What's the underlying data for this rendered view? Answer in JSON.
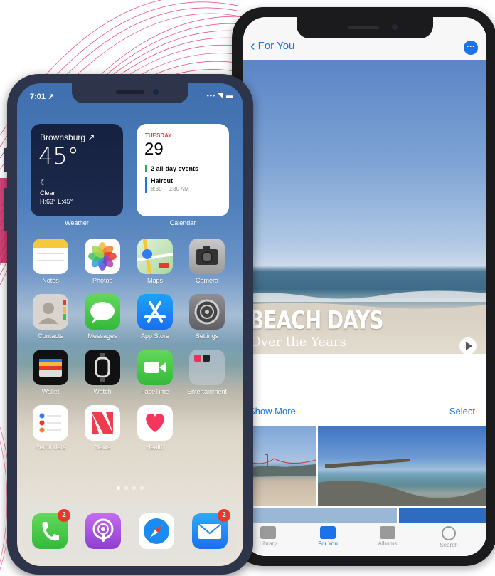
{
  "colors": {
    "accent": "#1a73e8",
    "phone_left_frame": "#2e3449",
    "phone_right_frame": "#1b1b1d",
    "badge": "#e8372c",
    "decor_lines": "#e0245e"
  },
  "left_phone": {
    "status": {
      "time": "7:01 ↗",
      "system": "••• ◥ ▬"
    },
    "weather_widget": {
      "city": "Brownsburg ↗",
      "temp": "45°",
      "moon": "☾",
      "condition": "Clear",
      "hilo": "H:63° L:45°",
      "label": "Weather"
    },
    "calendar_widget": {
      "day": "TUESDAY",
      "date": "29",
      "event1": "2 all-day events",
      "event2_title": "Haircut",
      "event2_time": "8:30 – 9:30 AM",
      "label": "Calendar"
    },
    "apps": [
      {
        "label": "Notes",
        "icon": "notes-icon"
      },
      {
        "label": "Photos",
        "icon": "photos-icon"
      },
      {
        "label": "Maps",
        "icon": "maps-icon"
      },
      {
        "label": "Camera",
        "icon": "camera-icon"
      },
      {
        "label": "Contacts",
        "icon": "contacts-icon"
      },
      {
        "label": "Messages",
        "icon": "messages-icon"
      },
      {
        "label": "App Store",
        "icon": "app-store-icon"
      },
      {
        "label": "Settings",
        "icon": "settings-icon"
      },
      {
        "label": "Wallet",
        "icon": "wallet-icon"
      },
      {
        "label": "Watch",
        "icon": "watch-icon"
      },
      {
        "label": "FaceTime",
        "icon": "facetime-icon"
      },
      {
        "label": "Entertainment",
        "icon": "entertainment-folder-icon"
      },
      {
        "label": "Reminders",
        "icon": "reminders-icon"
      },
      {
        "label": "News",
        "icon": "news-icon"
      },
      {
        "label": "Health",
        "icon": "health-icon"
      }
    ],
    "page_dots": {
      "total": 4,
      "current": 1
    },
    "dock": [
      {
        "name": "Phone",
        "icon": "phone-icon",
        "badge": "2"
      },
      {
        "name": "Podcasts",
        "icon": "podcasts-icon"
      },
      {
        "name": "Safari",
        "icon": "safari-icon"
      },
      {
        "name": "Mail",
        "icon": "mail-icon",
        "badge": "2"
      }
    ]
  },
  "right_phone": {
    "nav": {
      "back_label": "For You",
      "back_icon": "chevron-left-icon",
      "more_icon": "more-icon"
    },
    "memory": {
      "title": "BEACH DAYS",
      "subtitle": "Over the Years",
      "play_icon": "play-icon"
    },
    "section": {
      "show_more": "Show More",
      "select": "Select"
    },
    "tabs": [
      {
        "label": "Library",
        "icon": "library-icon",
        "active": false
      },
      {
        "label": "For You",
        "icon": "for-you-icon",
        "active": true
      },
      {
        "label": "Albums",
        "icon": "albums-icon",
        "active": false
      },
      {
        "label": "Search",
        "icon": "search-icon",
        "active": false
      }
    ]
  }
}
